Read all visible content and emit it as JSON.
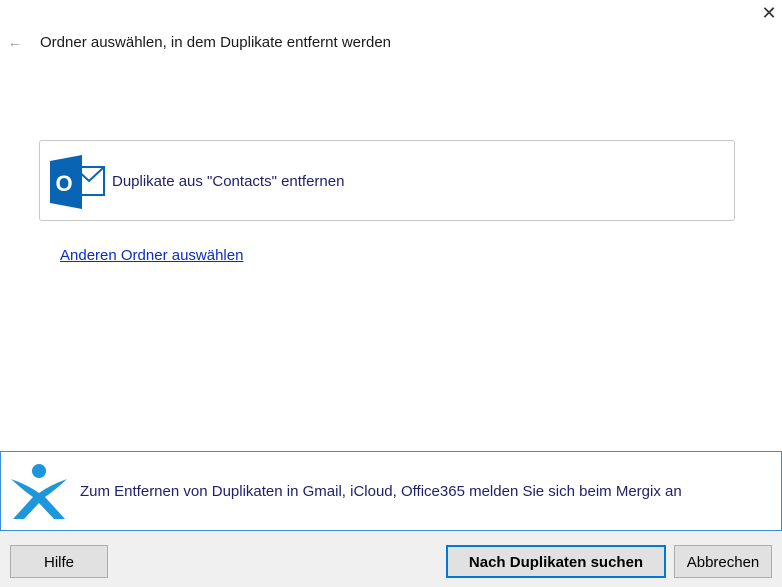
{
  "header": {
    "title": "Ordner auswählen, in dem Duplikate entfernt werden",
    "back_icon": "back-arrow-icon",
    "close_icon": "close-icon"
  },
  "option_card": {
    "label": "Duplikate aus \"Contacts\" entfernen",
    "icon": "outlook-icon"
  },
  "choose_other_link": "Anderen Ordner auswählen",
  "banner": {
    "text": "Zum Entfernen von Duplikaten in Gmail, iCloud, Office365 melden Sie sich beim Mergix an",
    "icon": "mergix-logo-icon"
  },
  "footer": {
    "help_label": "Hilfe",
    "search_label": "Nach Duplikaten suchen",
    "cancel_label": "Abbrechen"
  },
  "colors": {
    "accent": "#0078d7",
    "outlook_blue": "#0a64b4",
    "link": "#0a2cc8",
    "text_navy": "#1f1f6b",
    "banner_border": "#3c8fd6"
  }
}
